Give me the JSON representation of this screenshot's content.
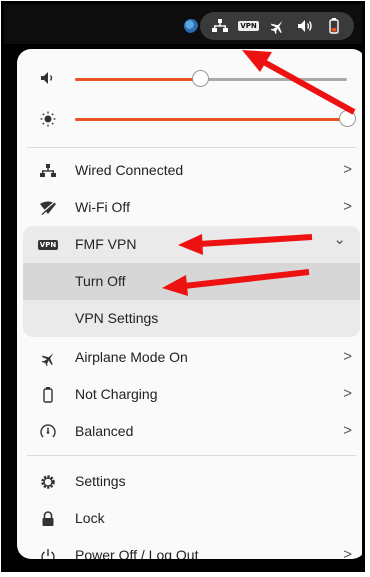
{
  "topbar": {
    "tray_icons": [
      "network-wired-icon",
      "vpn-icon",
      "airplane-icon",
      "volume-icon",
      "battery-icon"
    ],
    "vpn_badge": "VPN"
  },
  "sliders": {
    "volume_level": 0.46,
    "brightness_level": 1.0
  },
  "items": {
    "wired": "Wired Connected",
    "wifi": "Wi-Fi Off",
    "vpn": "FMF VPN",
    "vpn_turn_off": "Turn Off",
    "vpn_settings": "VPN Settings",
    "airplane": "Airplane Mode On",
    "battery": "Not Charging",
    "power_mode": "Balanced",
    "settings": "Settings",
    "lock": "Lock",
    "power": "Power Off / Log Out"
  },
  "chevron_right": ">",
  "chevron_down": "⌄",
  "colors": {
    "accent": "#e95420",
    "annotation": "#ee1111"
  }
}
